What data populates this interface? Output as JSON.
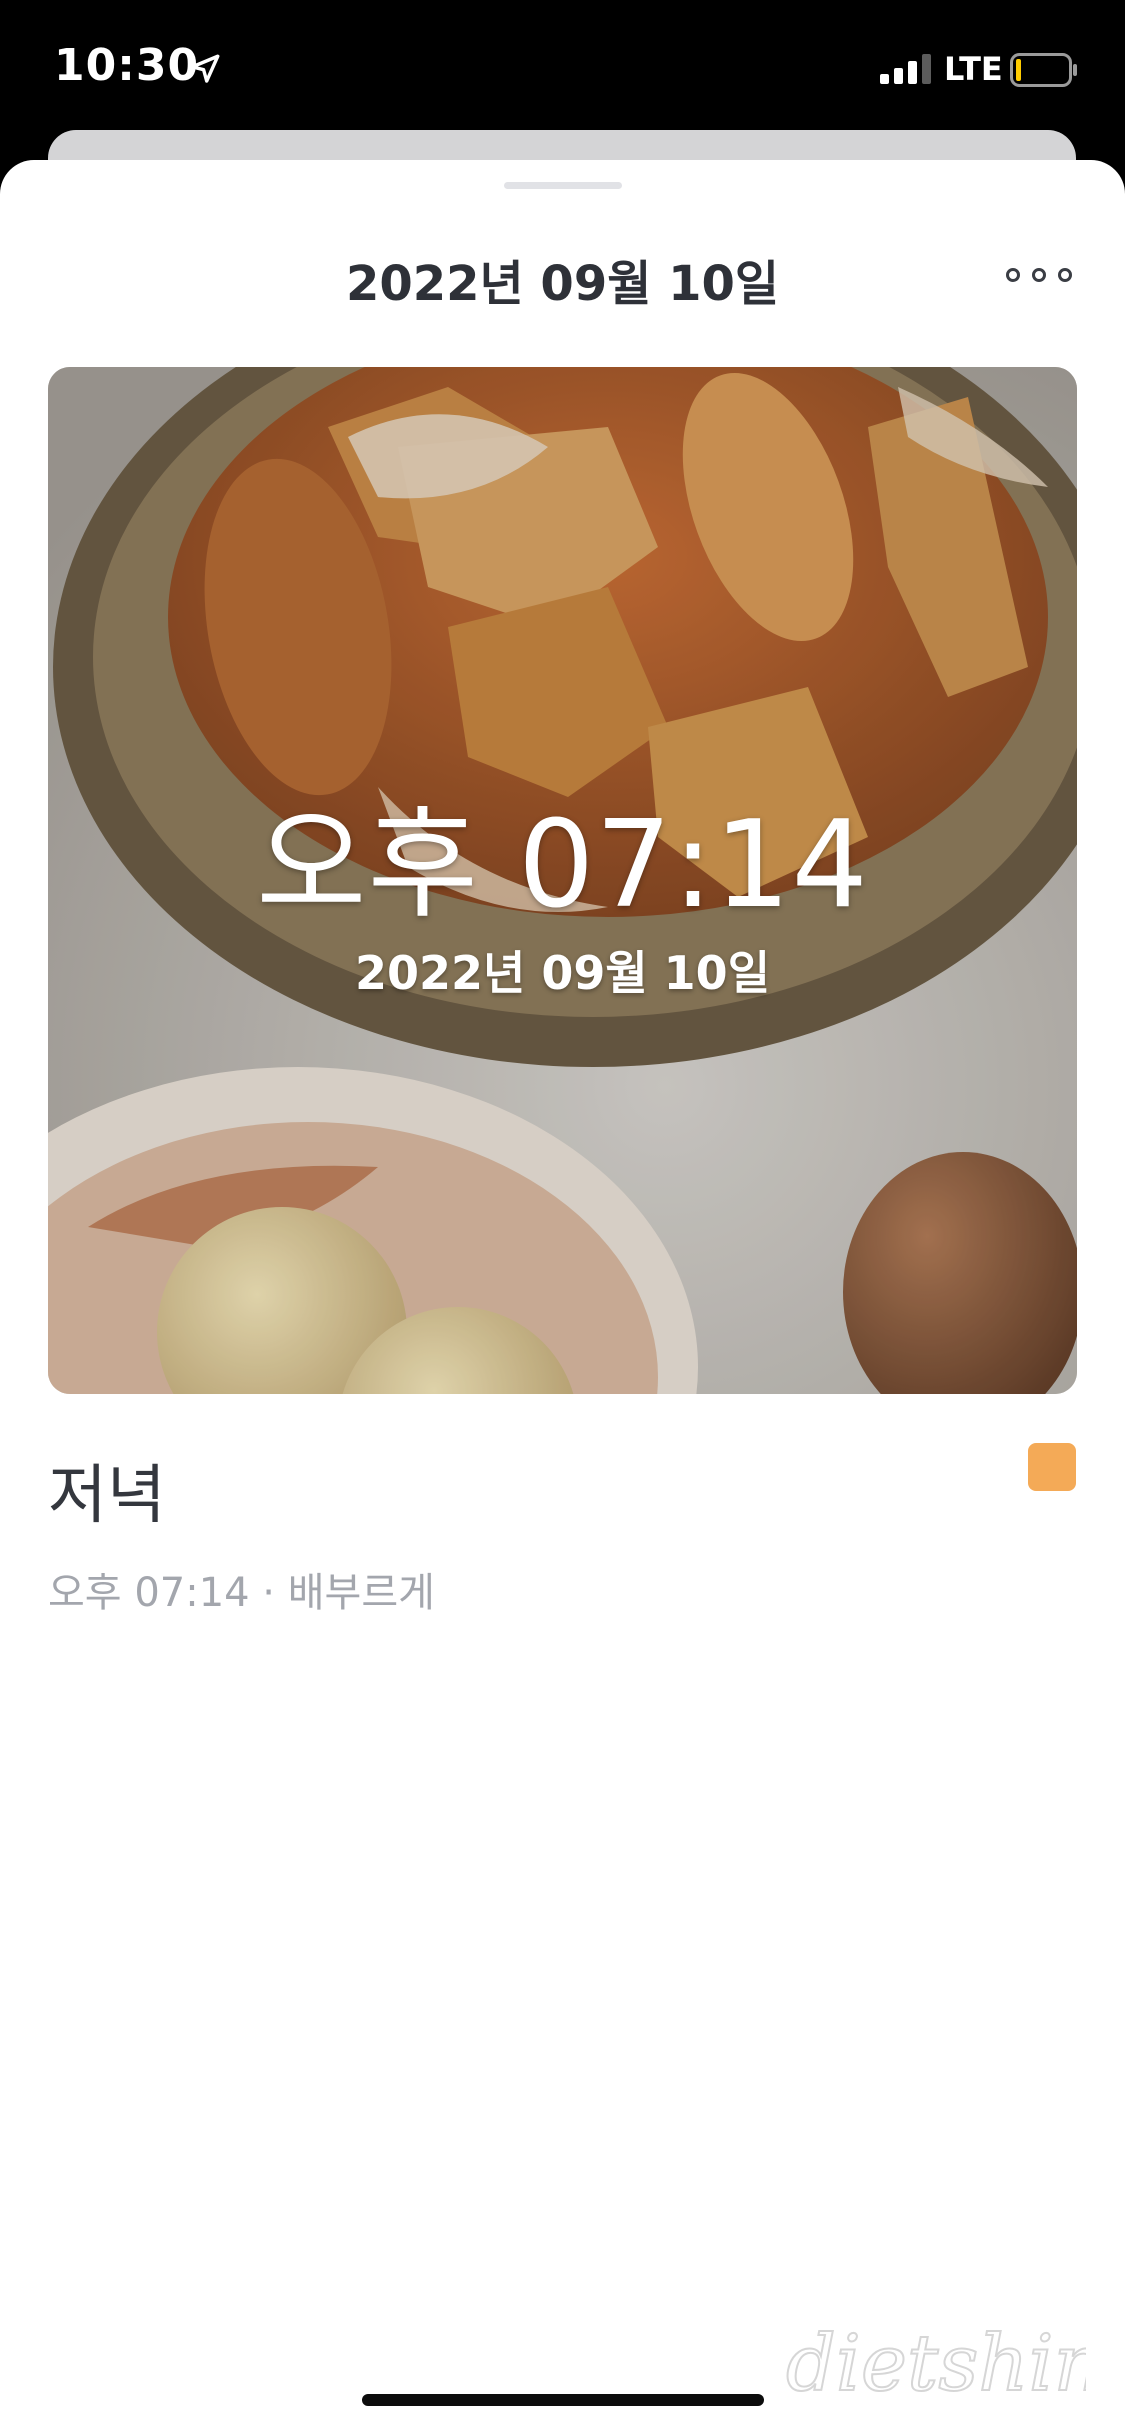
{
  "status_bar": {
    "time": "10:30",
    "network": "LTE",
    "icons": [
      "location-arrow-icon",
      "signal-bars-icon",
      "battery-low-icon"
    ]
  },
  "header": {
    "title": "2022년 09월 10일",
    "more_icon": "more-dots-icon"
  },
  "photo": {
    "overlay_time": "오후 07:14",
    "overlay_date": "2022년 09월 10일"
  },
  "entry": {
    "meal": "저녁",
    "meta": "오후 07:14 · 배부르게",
    "tag_color": "#F4AA57"
  },
  "watermark": "dietshin.com"
}
